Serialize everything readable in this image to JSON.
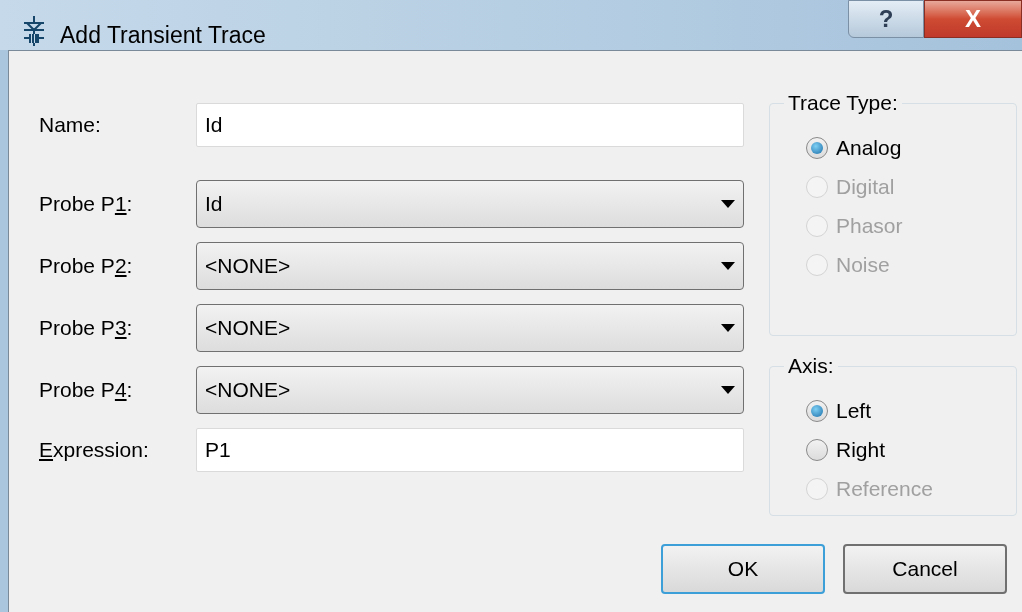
{
  "window": {
    "title": "Add Transient Trace",
    "help_button": "?",
    "close_button": "X"
  },
  "name_field": {
    "label": "Name:",
    "value": "Id"
  },
  "probes": [
    {
      "label_before": "Probe P",
      "mnemonic": "1",
      "label_after": ":",
      "value": "Id"
    },
    {
      "label_before": "Probe P",
      "mnemonic": "2",
      "label_after": ":",
      "value": "<NONE>"
    },
    {
      "label_before": "Probe P",
      "mnemonic": "3",
      "label_after": ":",
      "value": "<NONE>"
    },
    {
      "label_before": "Probe P",
      "mnemonic": "4",
      "label_after": ":",
      "value": "<NONE>"
    }
  ],
  "expression_field": {
    "mnemonic": "E",
    "label_after": "xpression:",
    "value": "P1"
  },
  "trace_type": {
    "title": "Trace Type:",
    "options": [
      {
        "label": "Analog",
        "selected": true,
        "disabled": false
      },
      {
        "label": "Digital",
        "selected": false,
        "disabled": true
      },
      {
        "label": "Phasor",
        "selected": false,
        "disabled": true
      },
      {
        "label": "Noise",
        "selected": false,
        "disabled": true
      }
    ]
  },
  "axis": {
    "title": "Axis:",
    "options": [
      {
        "label": "Left",
        "selected": true,
        "disabled": false
      },
      {
        "label": "Right",
        "selected": false,
        "disabled": false
      },
      {
        "label": "Reference",
        "selected": false,
        "disabled": true
      }
    ]
  },
  "buttons": [
    {
      "label": "OK",
      "default": true
    },
    {
      "label": "Cancel",
      "default": false
    }
  ]
}
